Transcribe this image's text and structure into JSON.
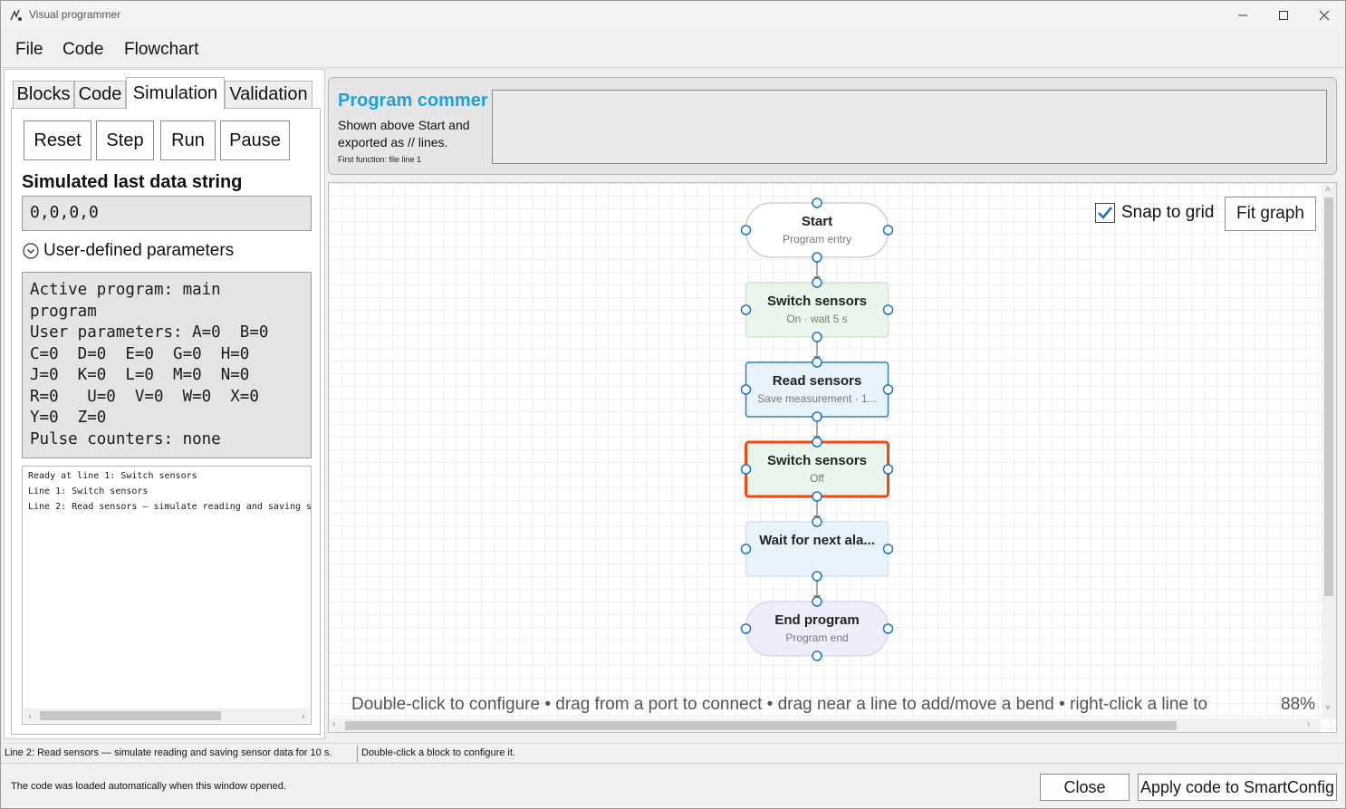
{
  "window": {
    "title": "Visual programmer"
  },
  "menu": [
    "File",
    "Code",
    "Flowchart"
  ],
  "tabs": [
    "Blocks",
    "Code",
    "Simulation",
    "Validation"
  ],
  "active_tab": "Simulation",
  "simulation": {
    "buttons": {
      "reset": "Reset",
      "step": "Step",
      "run": "Run",
      "pause": "Pause"
    },
    "last_data_label": "Simulated last data string",
    "last_data_value": "0,0,0,0",
    "params_toggle": "User-defined parameters",
    "params_text": "Active program: main\nprogram\nUser parameters: A=0  B=0\nC=0  D=0  E=0  G=0  H=0\nJ=0  K=0  L=0  M=0  N=0\nR=0   U=0  V=0  W=0  X=0\nY=0  Z=0\nPulse counters: none",
    "log": [
      "Ready at line 1: Switch sensors",
      "Line 1: Switch sensors",
      "Line 2: Read sensors — simulate reading and saving s"
    ]
  },
  "comment": {
    "title": "Program commer",
    "description": "Shown above Start and exported as // lines.",
    "first_function": "First function: file line 1",
    "value": ""
  },
  "canvas": {
    "snap_label": "Snap to grid",
    "snap_checked": true,
    "fit_label": "Fit graph",
    "hint": "Double-click to configure • drag from a port to connect • drag near a line to add/move a bend • right-click a line to",
    "zoom": "88%"
  },
  "nodes": [
    {
      "title": "Start",
      "subtitle": "Program entry",
      "kind": "terminal",
      "fill": "#ffffff",
      "stroke": "#cfcfcf",
      "selected": false
    },
    {
      "title": "Switch sensors",
      "subtitle": "On · wait 5 s",
      "kind": "action",
      "fill": "#eaf6ec",
      "stroke": "#cde6d2",
      "selected": false
    },
    {
      "title": "Read sensors",
      "subtitle": "Save measurement · 1...",
      "kind": "action",
      "fill": "#e8f3fd",
      "stroke": "#2f7fd0",
      "selected": false
    },
    {
      "title": "Switch sensors",
      "subtitle": "Off",
      "kind": "action",
      "fill": "#eaf6ec",
      "stroke": "#f04a12",
      "selected": true
    },
    {
      "title": "Wait for next ala...",
      "subtitle": "",
      "kind": "action",
      "fill": "#e8f3fd",
      "stroke": "#d2e3f3",
      "selected": false
    },
    {
      "title": "End program",
      "subtitle": "Program end",
      "kind": "terminal",
      "fill": "#f1ecfb",
      "stroke": "#ddd3f1",
      "selected": false
    }
  ],
  "colors": {
    "port": "#1a73c7",
    "connector": "#888888",
    "accent": "#1da1dc"
  },
  "status": {
    "left": "Line 2: Read sensors — simulate reading and saving sensor data for 10 s.",
    "right": "Double-click a block to configure it."
  },
  "footer": {
    "message": "The code was loaded automatically when this window opened.",
    "close": "Close",
    "apply": "Apply code to SmartConfig"
  }
}
